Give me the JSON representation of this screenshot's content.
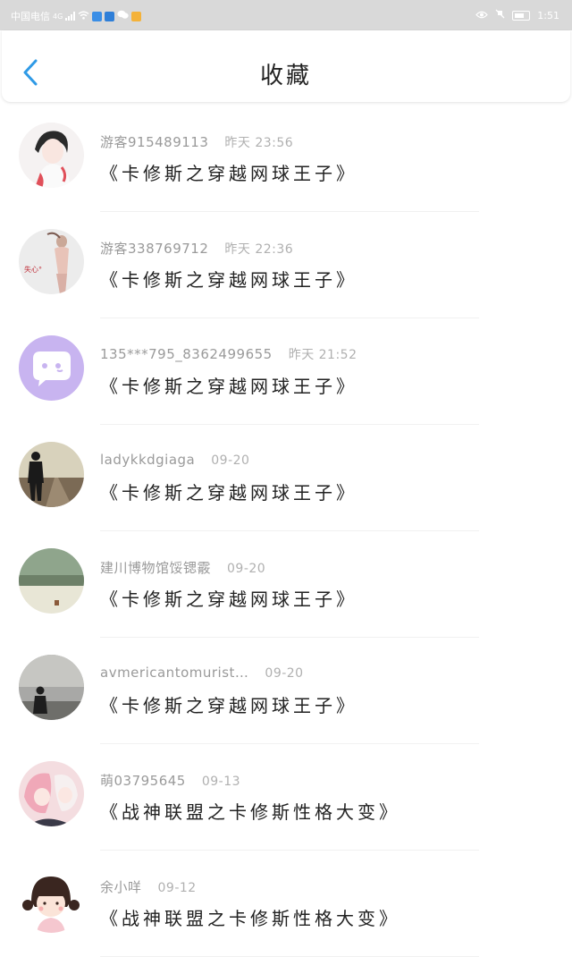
{
  "status_bar": {
    "carrier": "中国电信",
    "network": "4G",
    "time": "1:51"
  },
  "header": {
    "title": "收藏",
    "back_icon": "chevron-left-icon"
  },
  "colors": {
    "accent": "#2f9ae6",
    "status_bar_bg": "#d9d9d9",
    "username": "#9a9a9a",
    "work_title": "#222222"
  },
  "favorites": [
    {
      "user": "游客915489113",
      "time": "昨天 23:56",
      "work": "《卡修斯之穿越网球王子》",
      "avatar": "anime-girl-portrait"
    },
    {
      "user": "游客338769712",
      "time": "昨天 22:36",
      "work": "《卡修斯之穿越网球王子》",
      "avatar": "figure-photo",
      "avatar_text": "失心°"
    },
    {
      "user": "135***795_8362499655",
      "time": "昨天 21:52",
      "work": "《卡修斯之穿越网球王子》",
      "avatar": "default-chat-bubble"
    },
    {
      "user": "ladykkdgiaga",
      "time": "09-20",
      "work": "《卡修斯之穿越网球王子》",
      "avatar": "person-on-railroad"
    },
    {
      "user": "建川博物馆馁锶霰",
      "time": "09-20",
      "work": "《卡修斯之穿越网球王子》",
      "avatar": "snow-field-landscape"
    },
    {
      "user": "avmericantomurist…",
      "time": "09-20",
      "work": "《卡修斯之穿越网球王子》",
      "avatar": "silhouette-at-dusk"
    },
    {
      "user": "萌03795645",
      "time": "09-13",
      "work": "《战神联盟之卡修斯性格大变》",
      "avatar": "pink-anime-couple"
    },
    {
      "user": "余小咩",
      "time": "09-12",
      "work": "《战神联盟之卡修斯性格大变》",
      "avatar": "cartoon-girl-pigtails"
    }
  ]
}
